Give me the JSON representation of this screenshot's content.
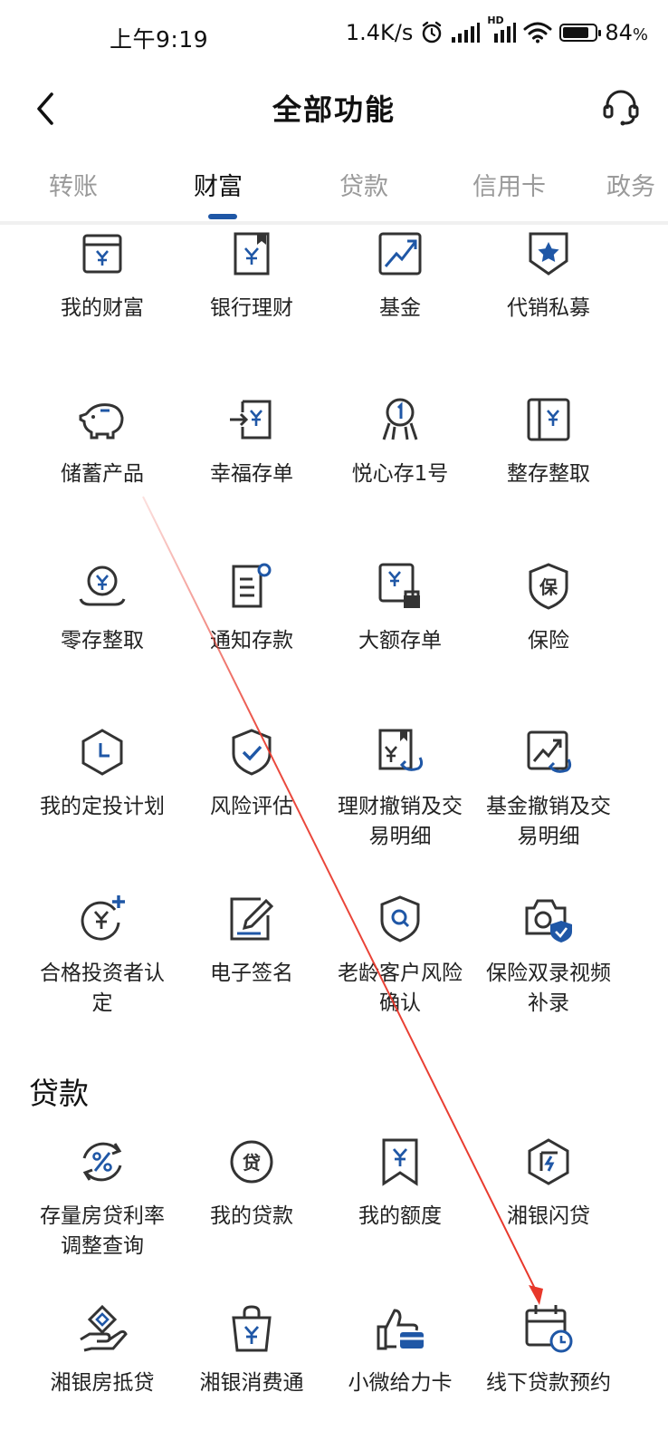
{
  "status_bar": {
    "time": "上午9:19",
    "net_speed": "1.4K/s",
    "battery_percent": "84",
    "battery_unit": "%",
    "battery_level": 0.84,
    "hd_label": "HD"
  },
  "header": {
    "title": "全部功能",
    "back_icon": "chevron-left-icon",
    "service_icon": "headset-icon"
  },
  "tabs": [
    {
      "label": "转账",
      "active": false
    },
    {
      "label": "财富",
      "active": true
    },
    {
      "label": "贷款",
      "active": false
    },
    {
      "label": "信用卡",
      "active": false
    },
    {
      "label": "政务",
      "active": false
    }
  ],
  "wealth_items": [
    {
      "label": "我的财富",
      "icon": "wallet-yen-icon"
    },
    {
      "label": "银行理财",
      "icon": "bookmark-yen-icon"
    },
    {
      "label": "基金",
      "icon": "trend-up-icon"
    },
    {
      "label": "代销私募",
      "icon": "shield-star-icon"
    },
    {
      "label": "储蓄产品",
      "icon": "piggy-bank-icon"
    },
    {
      "label": "幸福存单",
      "icon": "deposit-in-icon"
    },
    {
      "label": "悦心存1号",
      "icon": "medal-one-icon"
    },
    {
      "label": "整存整取",
      "icon": "passbook-yen-icon"
    },
    {
      "label": "零存整取",
      "icon": "coin-hand-icon"
    },
    {
      "label": "通知存款",
      "icon": "notice-doc-icon"
    },
    {
      "label": "大额存单",
      "icon": "large-deposit-icon"
    },
    {
      "label": "保险",
      "icon": "shield-insurance-icon"
    },
    {
      "label": "我的定投计划",
      "icon": "hexagon-clock-icon"
    },
    {
      "label": "风险评估",
      "icon": "shield-check-icon"
    },
    {
      "label": "理财撤销及交易明细",
      "icon": "doc-yen-return-icon"
    },
    {
      "label": "基金撤销及交易明细",
      "icon": "chart-return-icon"
    },
    {
      "label": "合格投资者认定",
      "icon": "yen-plus-icon"
    },
    {
      "label": "电子签名",
      "icon": "pen-sign-icon"
    },
    {
      "label": "老龄客户风险确认",
      "icon": "shield-search-icon"
    },
    {
      "label": "保险双录视频补录",
      "icon": "camera-shield-icon"
    }
  ],
  "loan_section": {
    "title": "贷款",
    "items": [
      {
        "label": "存量房贷利率调整查询",
        "icon": "percent-refresh-icon"
      },
      {
        "label": "我的贷款",
        "icon": "loan-coin-icon"
      },
      {
        "label": "我的额度",
        "icon": "ribbon-yen-icon"
      },
      {
        "label": "湘银闪贷",
        "icon": "hexagon-flash-icon"
      },
      {
        "label": "湘银房抵贷",
        "icon": "house-hand-icon"
      },
      {
        "label": "湘银消费通",
        "icon": "shopping-bag-yen-icon"
      },
      {
        "label": "小微给力卡",
        "icon": "thumbs-up-card-icon"
      },
      {
        "label": "线下贷款预约",
        "icon": "calendar-clock-icon"
      }
    ]
  },
  "colors": {
    "accent": "#1f57a6",
    "icon_stroke": "#333333",
    "annotation": "#e8372a"
  }
}
